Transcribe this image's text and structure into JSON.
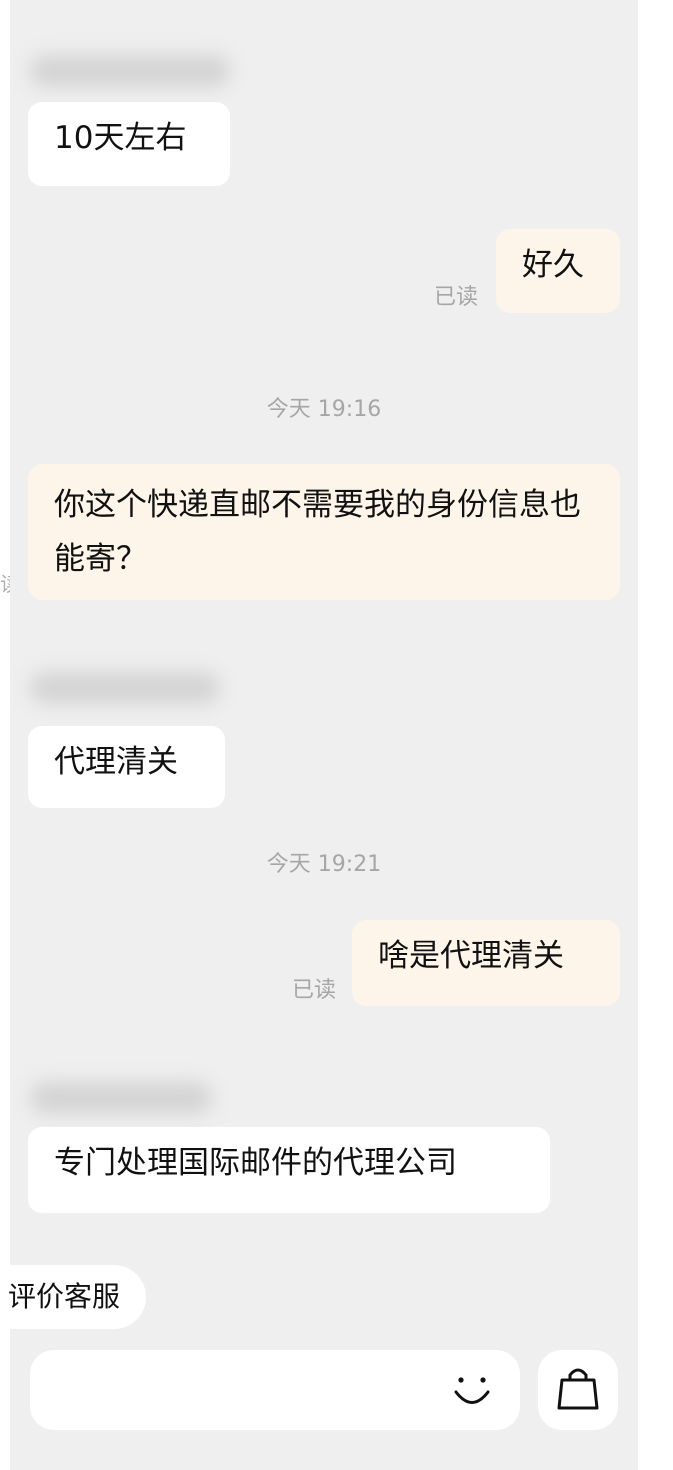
{
  "messages": [
    {
      "direction": "incoming",
      "text": "10天左右"
    },
    {
      "direction": "outgoing",
      "text": "好久",
      "status": "已读"
    },
    {
      "direction": "outgoing",
      "text": "你这个快递直邮不需要我的身份信息也能寄？"
    },
    {
      "direction": "incoming",
      "text": "代理清关"
    },
    {
      "direction": "outgoing",
      "text": "啥是代理清关",
      "status": "已读"
    },
    {
      "direction": "incoming",
      "text": "专门处理国际邮件的代理公司"
    }
  ],
  "timestamps": [
    "今天 19:16",
    "今天 19:21"
  ],
  "edge_glyph": "读",
  "rate_service_label": "评价客服",
  "icons": {
    "emoji": "smiley-face-icon",
    "bag": "shopping-bag-icon"
  }
}
